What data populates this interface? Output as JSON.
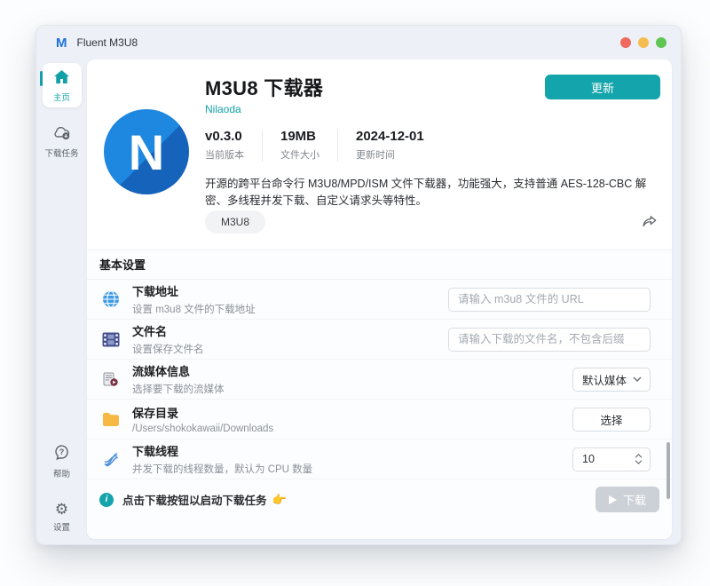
{
  "window": {
    "title": "Fluent M3U8"
  },
  "traffic_lights": {
    "close": "#ee6a5f",
    "minimize": "#f5bd4f",
    "zoom": "#61c554"
  },
  "sidebar": {
    "top": [
      {
        "label": "主页"
      },
      {
        "label": "下载任务"
      }
    ],
    "bottom": [
      {
        "label": "帮助"
      },
      {
        "label": "设置"
      }
    ]
  },
  "header": {
    "title": "M3U8 下载器",
    "author": "Nilaoda",
    "update_button": "更新",
    "icon_letter": "N",
    "stats": [
      {
        "value": "v0.3.0",
        "label": "当前版本"
      },
      {
        "value": "19MB",
        "label": "文件大小"
      },
      {
        "value": "2024-12-01",
        "label": "更新时间"
      }
    ],
    "description": "开源的跨平台命令行 M3U8/MPD/ISM 文件下载器，功能强大，支持普通 AES-128-CBC 解密、多线程并发下载、自定义请求头等特性。",
    "tag": "M3U8"
  },
  "settings": {
    "section_title": "基本设置",
    "rows": [
      {
        "title": "下载地址",
        "subtitle": "设置 m3u8 文件的下载地址",
        "control": "input",
        "placeholder": "请输入 m3u8 文件的 URL"
      },
      {
        "title": "文件名",
        "subtitle": "设置保存文件名",
        "control": "input",
        "placeholder": "请输入下载的文件名，不包含后缀"
      },
      {
        "title": "流媒体信息",
        "subtitle": "选择要下载的流媒体",
        "control": "select",
        "value": "默认媒体"
      },
      {
        "title": "保存目录",
        "subtitle": "/Users/shokokawaii/Downloads",
        "control": "button",
        "value": "选择"
      },
      {
        "title": "下载线程",
        "subtitle": "并发下载的线程数量，默认为 CPU 数量",
        "control": "number",
        "value": "10"
      }
    ],
    "footer": {
      "message": "点击下载按钮以启动下载任务",
      "pointer": "👉",
      "download_button": "下载"
    }
  },
  "icons": {
    "app_logo_letter": "M",
    "gear_glyph": "⚙",
    "help_glyph": "?",
    "info_glyph": "i"
  },
  "colors": {
    "accent": "#14a4ab",
    "app_icon_blue": "#1e87e0",
    "folder_orange": "#f7b844",
    "disabled_button": "#ccd1d7"
  }
}
